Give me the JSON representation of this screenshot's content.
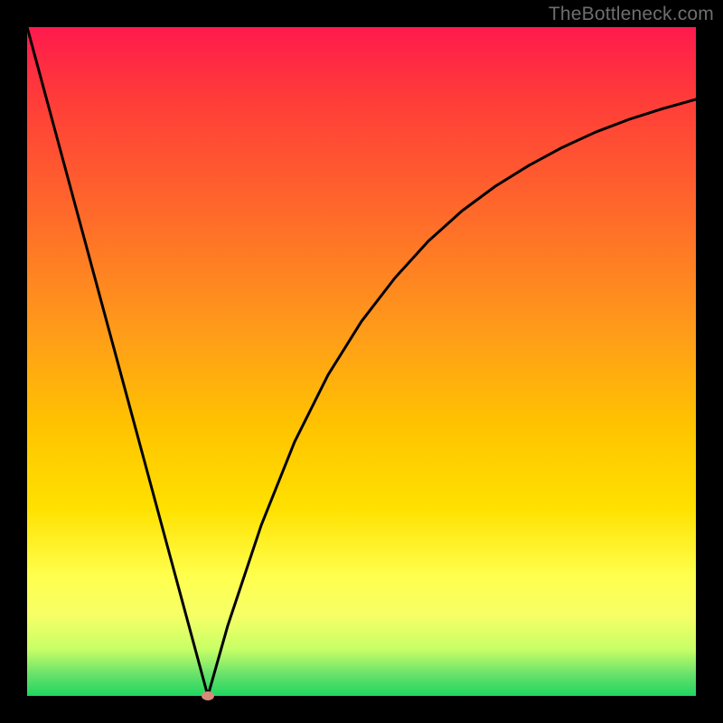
{
  "watermark": "TheBottleneck.com",
  "colors": {
    "frame": "#000000",
    "gradient_top": "#ff1a4d",
    "gradient_bottom": "#1fd65f",
    "curve": "#000000",
    "marker": "#d88a7a",
    "watermark_text": "#6e6e6e"
  },
  "chart_data": {
    "type": "line",
    "title": "",
    "xlabel": "",
    "ylabel": "",
    "xlim": [
      0,
      100
    ],
    "ylim": [
      0,
      100
    ],
    "grid": false,
    "legend": false,
    "series": [
      {
        "name": "bottleneck-curve",
        "x": [
          0,
          2.5,
          5,
          7.5,
          10,
          12.5,
          15,
          17.5,
          20,
          22.5,
          25,
          27.027,
          30,
          35,
          40,
          45,
          50,
          55,
          60,
          65,
          70,
          75,
          80,
          85,
          90,
          95,
          100
        ],
        "y": [
          100,
          90.75,
          81.5,
          72.25,
          63,
          53.75,
          44.5,
          35.25,
          26,
          16.75,
          7.5,
          0,
          10.5,
          25.5,
          38,
          48,
          56,
          62.5,
          68,
          72.5,
          76.2,
          79.3,
          82,
          84.3,
          86.2,
          87.8,
          89.2
        ]
      }
    ],
    "markers": [
      {
        "name": "optimal-point",
        "x": 27.027,
        "y": 0
      }
    ],
    "notes": "Values are read off the visual: vertical position encodes bottleneck %, minimum ≈27% along x with ~0% bottleneck; left branch is roughly linear from 100→0, right branch rises asymptotically toward ~89%."
  }
}
